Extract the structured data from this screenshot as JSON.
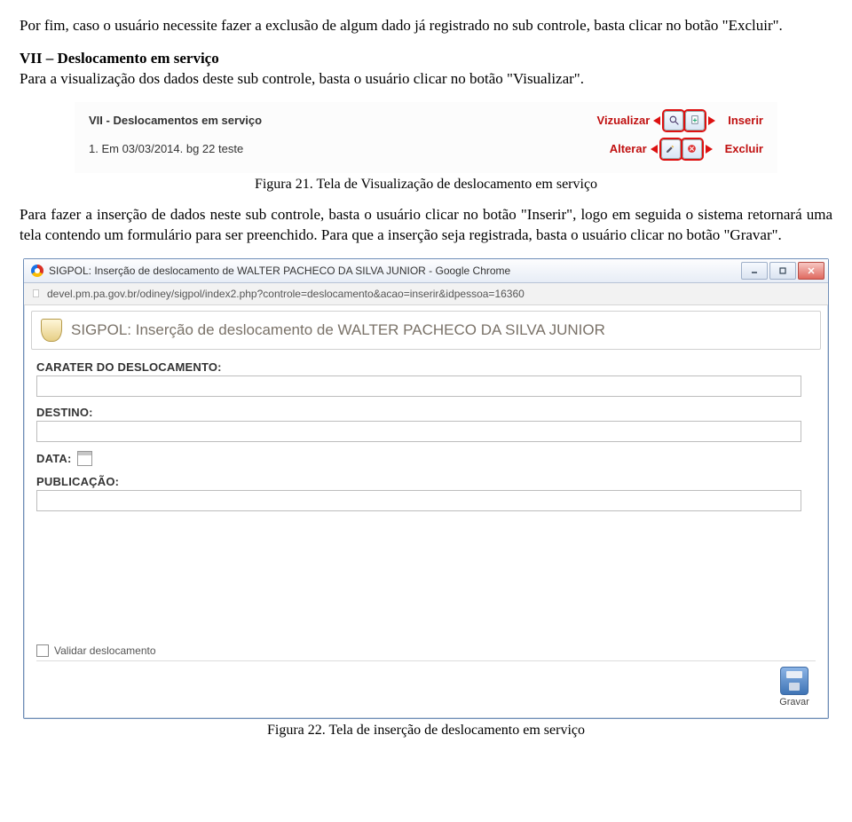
{
  "para1": "Por fim, caso o usuário necessite fazer a exclusão de algum dado já registrado no sub controle, basta clicar no botão \"Excluir\".",
  "section7": {
    "title": "VII – Deslocamento em serviço",
    "body": "Para a visualização dos dados deste sub controle, basta o usuário clicar no botão \"Visualizar\"."
  },
  "fig21": {
    "panel_title": "VII - Deslocamentos em serviço",
    "item_text": "1. Em 03/03/2014. bg 22 teste",
    "labels": {
      "visualizar": "Vizualizar",
      "inserir": "Inserir",
      "alterar": "Alterar",
      "excluir": "Excluir"
    },
    "caption": "Figura 21. Tela de Visualização de deslocamento em serviço"
  },
  "para2": "Para fazer a inserção de dados neste sub controle, basta o usuário clicar no botão \"Inserir\", logo em seguida o sistema retornará uma tela contendo um formulário para ser preenchido. Para que a inserção seja registrada, basta o usuário clicar no botão \"Gravar\".",
  "fig22": {
    "window_title": "SIGPOL: Inserção de deslocamento de WALTER PACHECO DA SILVA JUNIOR - Google Chrome",
    "url": "devel.pm.pa.gov.br/odiney/sigpol/index2.php?controle=deslocamento&acao=inserir&idpessoa=16360",
    "page_header": "SIGPOL: Inserção de deslocamento de WALTER PACHECO DA SILVA JUNIOR",
    "fields": {
      "carater": "CARATER DO DESLOCAMENTO:",
      "destino": "DESTINO:",
      "data": "DATA:",
      "publicacao": "PUBLICAÇÃO:"
    },
    "checkbox_label": "Validar deslocamento",
    "save_label": "Gravar",
    "caption": "Figura 22. Tela de inserção de deslocamento em serviço"
  }
}
